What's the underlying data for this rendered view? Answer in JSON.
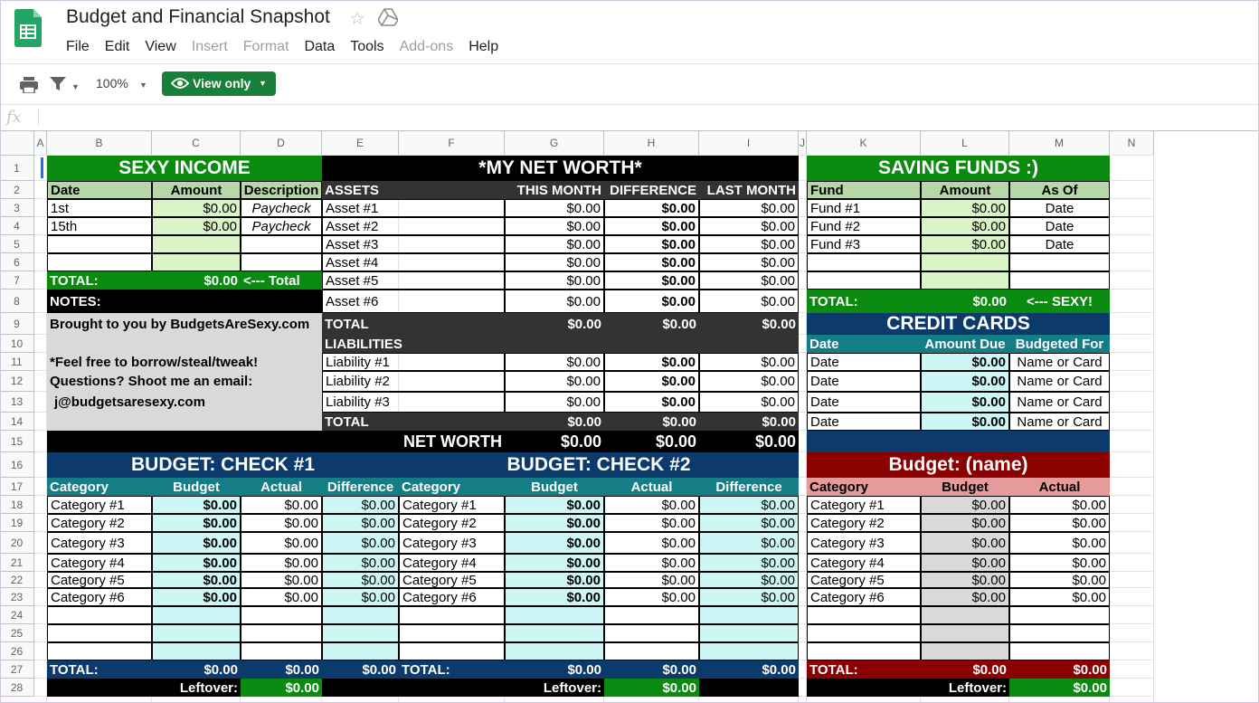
{
  "doc": {
    "title": "Budget and Financial Snapshot",
    "star_icon": "star-outline-icon",
    "drive_icon": "drive-icon",
    "menu": [
      {
        "label": "File",
        "enabled": true
      },
      {
        "label": "Edit",
        "enabled": true
      },
      {
        "label": "View",
        "enabled": true
      },
      {
        "label": "Insert",
        "enabled": false
      },
      {
        "label": "Format",
        "enabled": false
      },
      {
        "label": "Data",
        "enabled": true
      },
      {
        "label": "Tools",
        "enabled": true
      },
      {
        "label": "Add-ons",
        "enabled": false
      },
      {
        "label": "Help",
        "enabled": true
      }
    ]
  },
  "toolbar": {
    "zoom": "100%",
    "view_only": "View only"
  },
  "formula_bar": {
    "fx": "fx",
    "value": ""
  },
  "columns": [
    "A",
    "B",
    "C",
    "D",
    "E",
    "F",
    "G",
    "H",
    "I",
    "J",
    "K",
    "L",
    "M",
    "N"
  ],
  "rows": [
    "1",
    "2",
    "3",
    "4",
    "5",
    "6",
    "7",
    "8",
    "9",
    "10",
    "11",
    "12",
    "13",
    "14",
    "15",
    "16",
    "17",
    "18",
    "19",
    "20",
    "21",
    "22",
    "23",
    "24",
    "25",
    "26",
    "27",
    "28"
  ],
  "colors": {
    "income_header": "#0a8a0f",
    "income_sub": "#b6d7a8",
    "money_input": "#d9f5c5",
    "networth_header": "#000000",
    "networth_sub": "#333333",
    "budget_header": "#0c3a6b",
    "budget_sub": "#147d86",
    "budget_input": "#cdf6f6",
    "credit_header": "#0c3a6b",
    "credit_sub": "#147d86",
    "name_header": "#8b0000",
    "name_sub": "#e69a9a",
    "name_input": "#d9d9d9",
    "leftover": "#0a8a0f",
    "notes_bg": "#d9d9d9"
  },
  "income": {
    "title": "SEXY INCOME",
    "headers": [
      "Date",
      "Amount",
      "Description"
    ],
    "rows": [
      {
        "date": "1st",
        "amount": "$0.00",
        "desc": "Paycheck"
      },
      {
        "date": "15th",
        "amount": "$0.00",
        "desc": "Paycheck"
      },
      {
        "date": "",
        "amount": "",
        "desc": ""
      },
      {
        "date": "",
        "amount": "",
        "desc": ""
      }
    ],
    "total_label": "TOTAL:",
    "total_value": "$0.00",
    "total_note": "<--- Total"
  },
  "notes": {
    "title": "NOTES:",
    "lines": [
      "Brought to you by BudgetsAreSexy.com",
      "",
      "*Feel free to borrow/steal/tweak!",
      "Questions? Shoot me an email:",
      "j@budgetsaresexy.com",
      ""
    ]
  },
  "networth": {
    "title": "*MY NET WORTH*",
    "headers": [
      "ASSETS",
      "THIS MONTH",
      "DIFFERENCE",
      "LAST MONTH"
    ],
    "assets": [
      {
        "name": "Asset #1",
        "this": "$0.00",
        "diff": "$0.00",
        "last": "$0.00"
      },
      {
        "name": "Asset #2",
        "this": "$0.00",
        "diff": "$0.00",
        "last": "$0.00"
      },
      {
        "name": "Asset #3",
        "this": "$0.00",
        "diff": "$0.00",
        "last": "$0.00"
      },
      {
        "name": "Asset #4",
        "this": "$0.00",
        "diff": "$0.00",
        "last": "$0.00"
      },
      {
        "name": "Asset #5",
        "this": "$0.00",
        "diff": "$0.00",
        "last": "$0.00"
      },
      {
        "name": "Asset #6",
        "this": "$0.00",
        "diff": "$0.00",
        "last": "$0.00"
      }
    ],
    "assets_total": {
      "label": "TOTAL",
      "this": "$0.00",
      "diff": "$0.00",
      "last": "$0.00"
    },
    "liabilities_label": "LIABILITIES",
    "liabilities": [
      {
        "name": "Liability #1",
        "this": "$0.00",
        "diff": "$0.00",
        "last": "$0.00"
      },
      {
        "name": "Liability #2",
        "this": "$0.00",
        "diff": "$0.00",
        "last": "$0.00"
      },
      {
        "name": "Liability #3",
        "this": "$0.00",
        "diff": "$0.00",
        "last": "$0.00"
      }
    ],
    "liabilities_total": {
      "label": "TOTAL",
      "this": "$0.00",
      "diff": "$0.00",
      "last": "$0.00"
    },
    "net_worth": {
      "label": "NET WORTH",
      "this": "$0.00",
      "diff": "$0.00",
      "last": "$0.00"
    }
  },
  "saving": {
    "title": "SAVING FUNDS :)",
    "headers": [
      "Fund",
      "Amount",
      "As Of"
    ],
    "rows": [
      {
        "fund": "Fund #1",
        "amount": "$0.00",
        "as_of": "Date"
      },
      {
        "fund": "Fund #2",
        "amount": "$0.00",
        "as_of": "Date"
      },
      {
        "fund": "Fund #3",
        "amount": "$0.00",
        "as_of": "Date"
      },
      {
        "fund": "",
        "amount": "",
        "as_of": ""
      },
      {
        "fund": "",
        "amount": "",
        "as_of": ""
      }
    ],
    "total_label": "TOTAL:",
    "total_value": "$0.00",
    "total_note": "<--- SEXY!"
  },
  "credit": {
    "title": "CREDIT CARDS",
    "headers": [
      "Date",
      "Amount Due",
      "Budgeted For"
    ],
    "rows": [
      {
        "date": "Date",
        "due": "$0.00",
        "for": "Name or Card"
      },
      {
        "date": "Date",
        "due": "$0.00",
        "for": "Name or Card"
      },
      {
        "date": "Date",
        "due": "$0.00",
        "for": "Name or Card"
      },
      {
        "date": "Date",
        "due": "$0.00",
        "for": "Name or Card"
      }
    ]
  },
  "budget1": {
    "title": "BUDGET: CHECK #1",
    "headers": [
      "Category",
      "Budget",
      "Actual",
      "Difference"
    ],
    "rows": [
      {
        "cat": "Category #1",
        "budget": "$0.00",
        "actual": "$0.00",
        "diff": "$0.00"
      },
      {
        "cat": "Category #2",
        "budget": "$0.00",
        "actual": "$0.00",
        "diff": "$0.00"
      },
      {
        "cat": "Category #3",
        "budget": "$0.00",
        "actual": "$0.00",
        "diff": "$0.00"
      },
      {
        "cat": "Category #4",
        "budget": "$0.00",
        "actual": "$0.00",
        "diff": "$0.00"
      },
      {
        "cat": "Category #5",
        "budget": "$0.00",
        "actual": "$0.00",
        "diff": "$0.00"
      },
      {
        "cat": "Category #6",
        "budget": "$0.00",
        "actual": "$0.00",
        "diff": "$0.00"
      }
    ],
    "total": {
      "label": "TOTAL:",
      "budget": "$0.00",
      "actual": "$0.00",
      "diff": "$0.00"
    },
    "leftover": {
      "label": "Leftover:",
      "value": "$0.00"
    }
  },
  "budget2": {
    "title": "BUDGET: CHECK #2",
    "headers": [
      "Category",
      "Budget",
      "Actual",
      "Difference"
    ],
    "rows": [
      {
        "cat": "Category #1",
        "budget": "$0.00",
        "actual": "$0.00",
        "diff": "$0.00"
      },
      {
        "cat": "Category #2",
        "budget": "$0.00",
        "actual": "$0.00",
        "diff": "$0.00"
      },
      {
        "cat": "Category #3",
        "budget": "$0.00",
        "actual": "$0.00",
        "diff": "$0.00"
      },
      {
        "cat": "Category #4",
        "budget": "$0.00",
        "actual": "$0.00",
        "diff": "$0.00"
      },
      {
        "cat": "Category #5",
        "budget": "$0.00",
        "actual": "$0.00",
        "diff": "$0.00"
      },
      {
        "cat": "Category #6",
        "budget": "$0.00",
        "actual": "$0.00",
        "diff": "$0.00"
      }
    ],
    "total": {
      "label": "TOTAL:",
      "budget": "$0.00",
      "actual": "$0.00",
      "diff": "$0.00"
    },
    "leftover": {
      "label": "Leftover:",
      "value": "$0.00"
    }
  },
  "budget3": {
    "title": "Budget: (name)",
    "headers": [
      "Category",
      "Budget",
      "Actual"
    ],
    "rows": [
      {
        "cat": "Category #1",
        "budget": "$0.00",
        "actual": "$0.00"
      },
      {
        "cat": "Category #2",
        "budget": "$0.00",
        "actual": "$0.00"
      },
      {
        "cat": "Category #3",
        "budget": "$0.00",
        "actual": "$0.00"
      },
      {
        "cat": "Category #4",
        "budget": "$0.00",
        "actual": "$0.00"
      },
      {
        "cat": "Category #5",
        "budget": "$0.00",
        "actual": "$0.00"
      },
      {
        "cat": "Category #6",
        "budget": "$0.00",
        "actual": "$0.00"
      }
    ],
    "total": {
      "label": "TOTAL:",
      "budget": "$0.00",
      "actual": "$0.00"
    },
    "leftover": {
      "label": "Leftover:",
      "value": "$0.00"
    }
  }
}
